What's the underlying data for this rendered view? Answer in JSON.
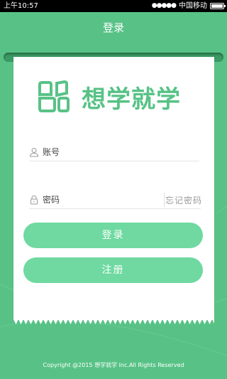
{
  "status_bar": {
    "time": "上午10:57",
    "signal": "●●●●●",
    "carrier": "中国移动"
  },
  "header": {
    "title": "登录"
  },
  "logo": {
    "text": "想学就学"
  },
  "form": {
    "account_placeholder": "账号",
    "password_placeholder": "密码",
    "forgot_password": "忘记密码",
    "login_button": "登录",
    "register_button": "注册"
  },
  "footer": {
    "copyright": "Copyright @2015 想学就学 Inc.All Rights Reserved"
  },
  "colors": {
    "background": "#58c286",
    "button": "#6fd9a1",
    "logo": "#58c286"
  }
}
